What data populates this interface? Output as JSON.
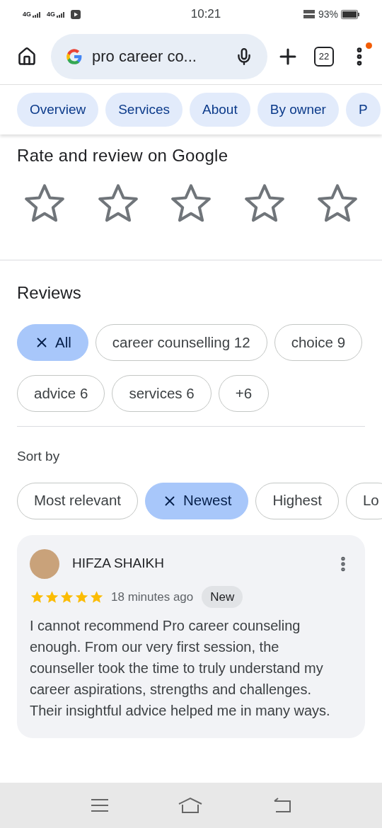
{
  "status_bar": {
    "network_1": "4G",
    "network_2": "4G",
    "time": "10:21",
    "battery": "93%"
  },
  "browser": {
    "query": "pro career co...",
    "tab_count": "22",
    "menu_badge": true
  },
  "tabs": [
    {
      "label": "Overview",
      "selected": false
    },
    {
      "label": "Services",
      "selected": false
    },
    {
      "label": "About",
      "selected": false
    },
    {
      "label": "By owner",
      "selected": false
    },
    {
      "label": "P",
      "selected": false
    }
  ],
  "rate": {
    "title": "Rate and review on Google",
    "stars": 0
  },
  "reviews": {
    "title": "Reviews",
    "filters": [
      {
        "label": "All",
        "selected": true
      },
      {
        "label": "career counselling",
        "count": "12",
        "selected": false
      },
      {
        "label": "choice",
        "count": "9",
        "selected": false
      },
      {
        "label": "advice",
        "count": "6",
        "selected": false
      },
      {
        "label": "services",
        "count": "6",
        "selected": false
      },
      {
        "label": "+6",
        "selected": false
      }
    ],
    "sort_title": "Sort by",
    "sort": [
      {
        "label": "Most relevant",
        "selected": false
      },
      {
        "label": "Newest",
        "selected": true
      },
      {
        "label": "Highest",
        "selected": false
      },
      {
        "label": "Lo",
        "selected": false
      }
    ],
    "items": [
      {
        "name": "HIFZA SHAIKH",
        "stars": 5,
        "time": "18 minutes ago",
        "badge": "New",
        "text": "I cannot recommend Pro career counseling enough. From our very first session, the counseller took the time to truly understand my career aspirations, strengths and challenges. Their insightful advice helped me in many ways."
      }
    ]
  }
}
